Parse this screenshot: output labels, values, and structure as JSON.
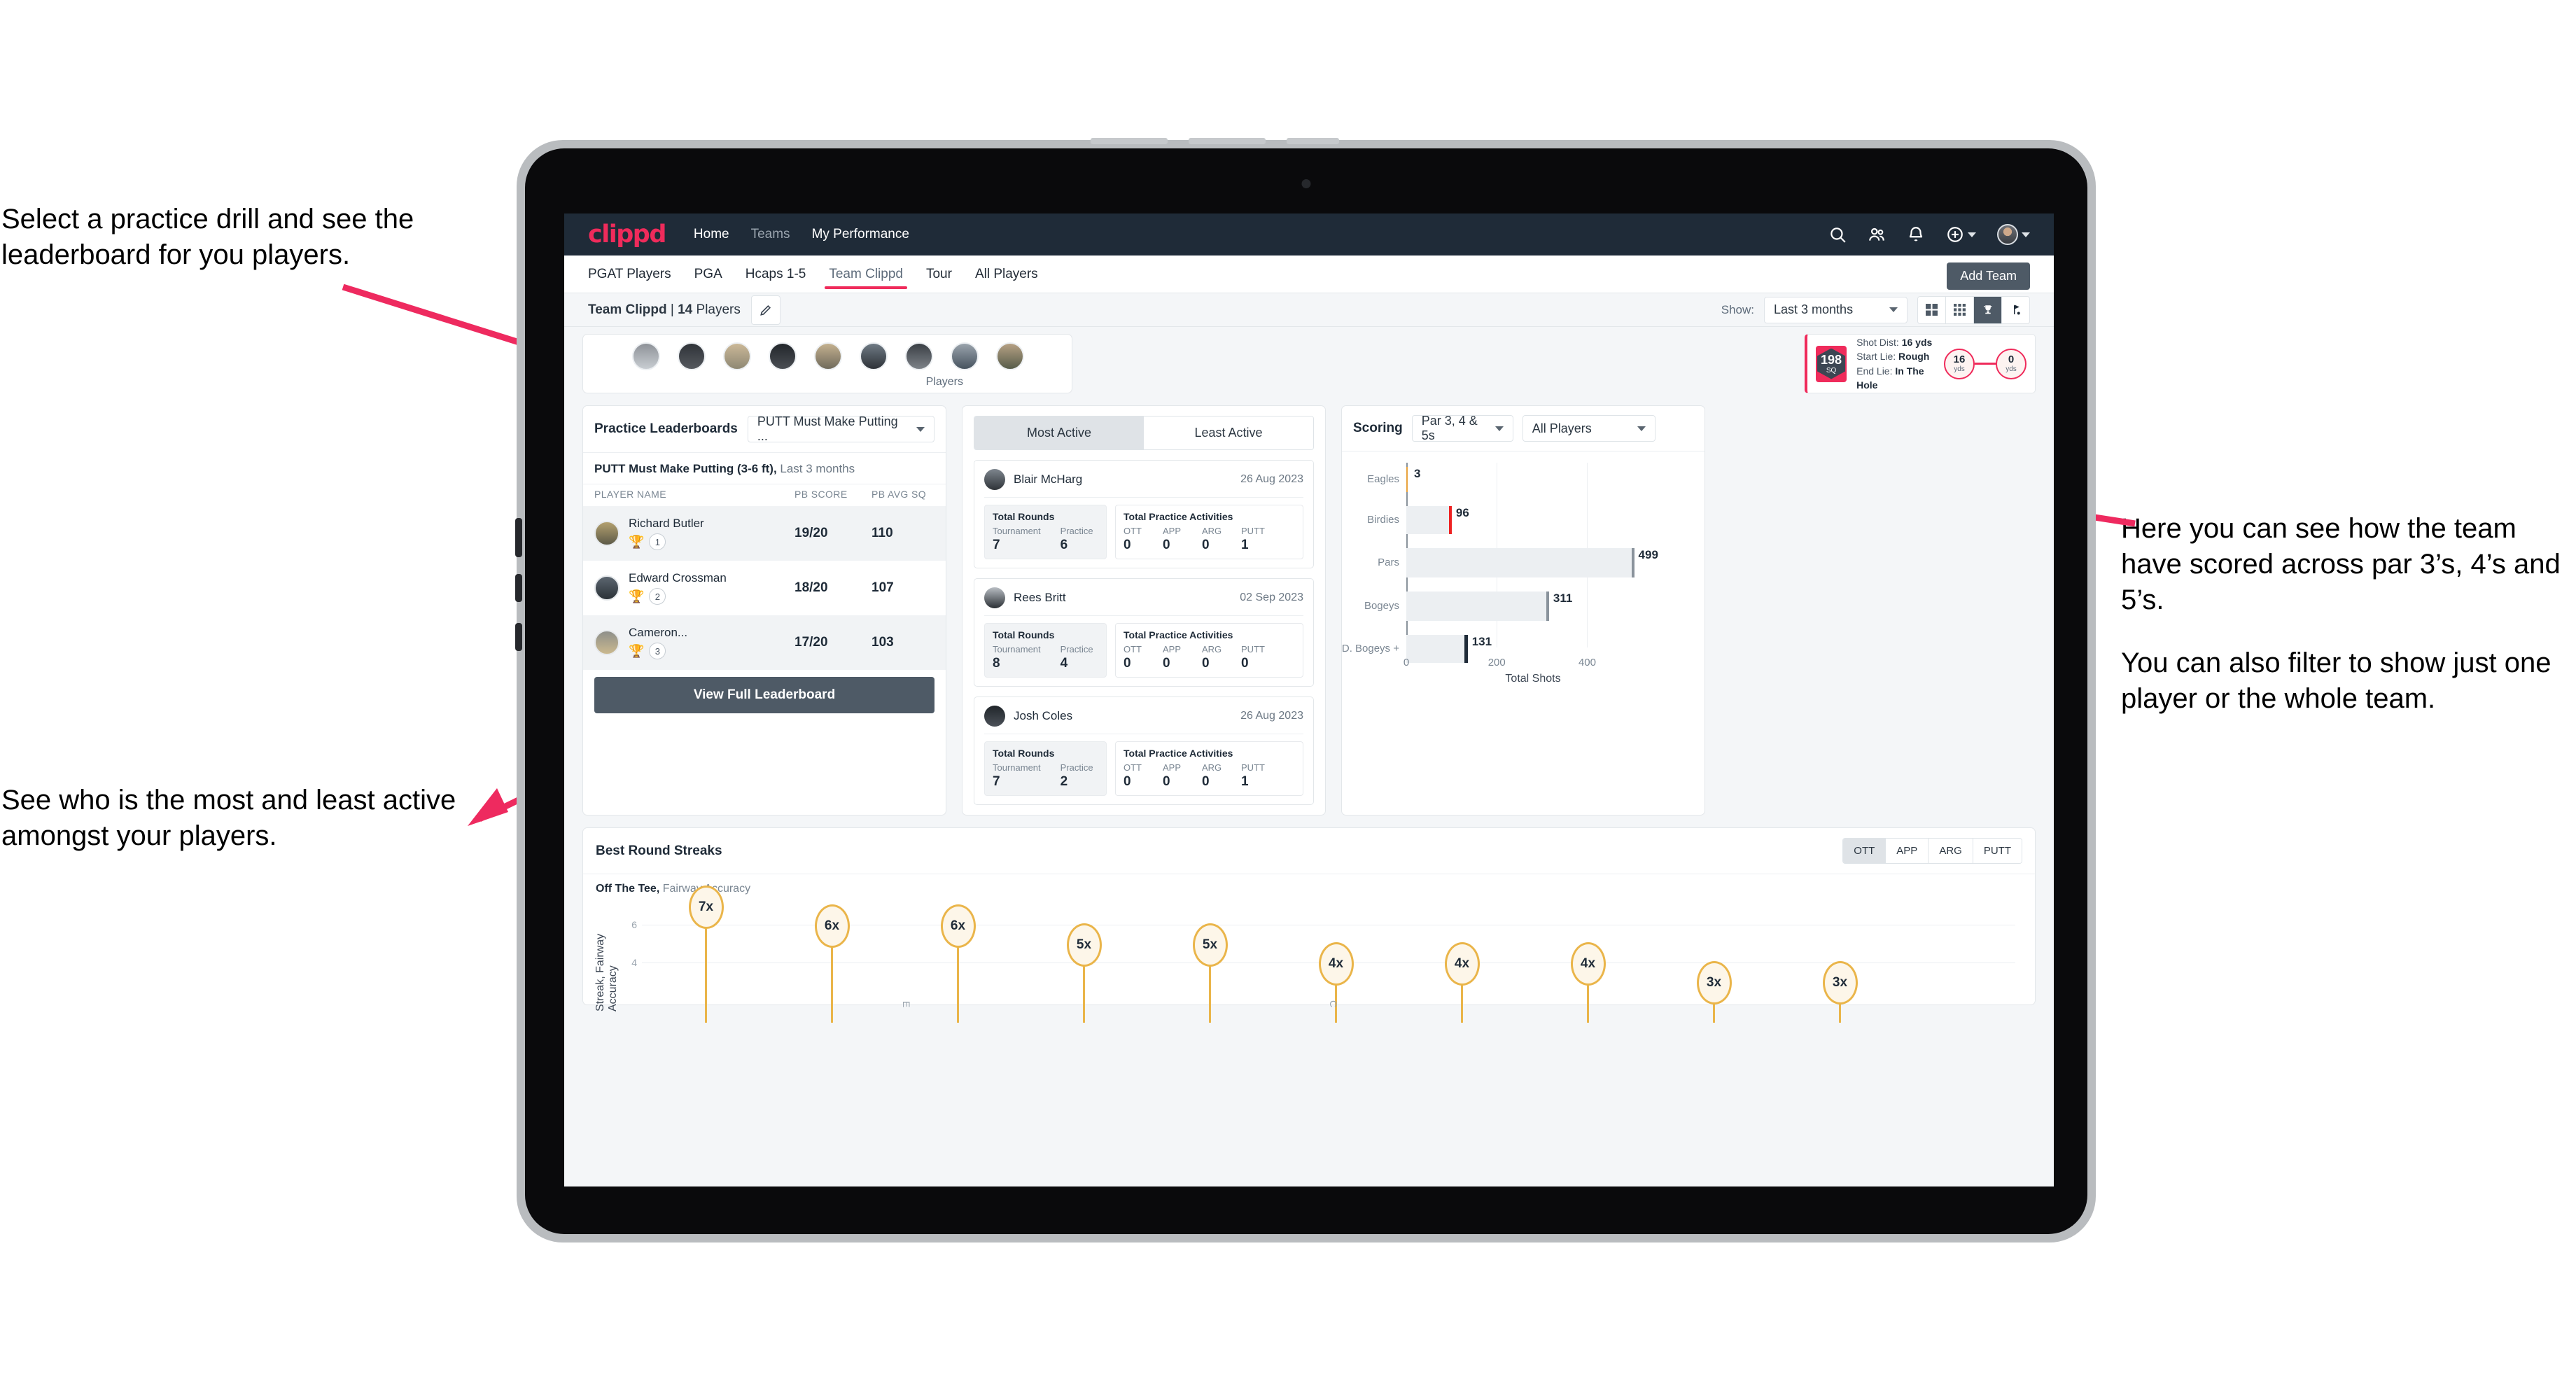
{
  "annotations": {
    "top_left": "Select a practice drill and see the leaderboard for you players.",
    "bottom_left": "See who is the most and least active amongst your players.",
    "right_1": "Here you can see how the team have scored across par 3’s, 4’s and 5’s.",
    "right_2": "You can also filter to show just one player or the whole team.",
    "arrow_color": "#ee2a5f"
  },
  "app": {
    "logo": "clippd",
    "nav": [
      {
        "label": "Home",
        "active": true
      },
      {
        "label": "Teams",
        "active": false
      },
      {
        "label": "My Performance",
        "active": true
      }
    ],
    "icons": {
      "search": "search-icon",
      "people": "people-icon",
      "bell": "bell-icon",
      "plus": "plus-circle-icon",
      "avatar": "user-avatar"
    },
    "tabs": [
      {
        "label": "PGAT Players",
        "active": false
      },
      {
        "label": "PGA",
        "active": false
      },
      {
        "label": "Hcaps 1-5",
        "active": false
      },
      {
        "label": "Team Clippd",
        "active": true
      },
      {
        "label": "Tour",
        "active": false
      },
      {
        "label": "All Players",
        "active": false
      }
    ],
    "add_team_label": "Add Team",
    "subbar": {
      "team_name": "Team Clippd",
      "player_count": "14",
      "players_word": "Players",
      "edit_icon": "pencil-icon",
      "show_label": "Show:",
      "range_value": "Last 3 months",
      "view_buttons": [
        {
          "icon": "grid-large-icon",
          "active": false
        },
        {
          "icon": "grid-small-icon",
          "active": false
        },
        {
          "icon": "trophy-icon",
          "active": true
        },
        {
          "icon": "flag-icon",
          "active": false
        }
      ]
    }
  },
  "player_strip": {
    "caption": "Players",
    "avatar_count": 9
  },
  "shot_card": {
    "sq_value": "198",
    "sq_unit": "SQ",
    "lines": [
      {
        "label": "Shot Dist:",
        "value": "16 yds"
      },
      {
        "label": "Start Lie:",
        "value": "Rough"
      },
      {
        "label": "End Lie:",
        "value": "In The Hole"
      }
    ],
    "start_dist": {
      "value": "16",
      "unit": "yds"
    },
    "end_dist": {
      "value": "0",
      "unit": "yds"
    }
  },
  "leaderboard": {
    "title": "Practice Leaderboards",
    "drill_select": "PUTT Must Make Putting ...",
    "subtitle_bold": "PUTT Must Make Putting (3-6 ft),",
    "subtitle_rest": " Last 3 months",
    "columns": [
      "PLAYER NAME",
      "PB SCORE",
      "PB AVG SQ"
    ],
    "rows": [
      {
        "name": "Richard Butler",
        "rank": "1",
        "trophy": "gold",
        "pb_score": "19/20",
        "pb_avg_sq": "110"
      },
      {
        "name": "Edward Crossman",
        "rank": "2",
        "trophy": "silver",
        "pb_score": "18/20",
        "pb_avg_sq": "107"
      },
      {
        "name": "Cameron...",
        "rank": "3",
        "trophy": "bronze",
        "pb_score": "17/20",
        "pb_avg_sq": "103"
      }
    ],
    "view_full_label": "View Full Leaderboard"
  },
  "activity": {
    "segments": [
      {
        "label": "Most Active",
        "active": true
      },
      {
        "label": "Least Active",
        "active": false
      }
    ],
    "rounds_title": "Total Rounds",
    "rounds_keys": [
      "Tournament",
      "Practice"
    ],
    "practice_title": "Total Practice Activities",
    "practice_keys": [
      "OTT",
      "APP",
      "ARG",
      "PUTT"
    ],
    "players": [
      {
        "name": "Blair McHarg",
        "date": "26 Aug 2023",
        "tournament": "7",
        "practice": "6",
        "ott": "0",
        "app": "0",
        "arg": "0",
        "putt": "1"
      },
      {
        "name": "Rees Britt",
        "date": "02 Sep 2023",
        "tournament": "8",
        "practice": "4",
        "ott": "0",
        "app": "0",
        "arg": "0",
        "putt": "0"
      },
      {
        "name": "Josh Coles",
        "date": "26 Aug 2023",
        "tournament": "7",
        "practice": "2",
        "ott": "0",
        "app": "0",
        "arg": "0",
        "putt": "1"
      }
    ]
  },
  "scoring": {
    "title": "Scoring",
    "par_select": "Par 3, 4 & 5s",
    "player_select": "All Players"
  },
  "streaks": {
    "title": "Best Round Streaks",
    "segments": [
      {
        "label": "OTT",
        "active": true
      },
      {
        "label": "APP",
        "active": false
      },
      {
        "label": "ARG",
        "active": false
      },
      {
        "label": "PUTT",
        "active": false
      }
    ],
    "subtitle_bold": "Off The Tee,",
    "subtitle_rest": " Fairway Accuracy"
  },
  "chart_data": [
    {
      "type": "bar",
      "orientation": "horizontal",
      "title": "Scoring",
      "categories": [
        "Eagles",
        "Birdies",
        "Pars",
        "Bogeys",
        "D. Bogeys +"
      ],
      "values": [
        3,
        96,
        499,
        311,
        131
      ],
      "cap_colors": [
        "#e8a33d",
        "#ee2222",
        "#8a939c",
        "#8a939c",
        "#1f2b38"
      ],
      "bar_color": "#eceff2",
      "xlabel": "Total Shots",
      "ylabel": "",
      "xlim": [
        0,
        560
      ],
      "xticks": [
        0,
        200,
        400
      ],
      "grid": true,
      "legend": "none"
    },
    {
      "type": "bar",
      "orientation": "vertical",
      "title": "Best Round Streaks",
      "subtitle": "Off The Tee, Fairway Accuracy",
      "categories": [
        "",
        "",
        "",
        "",
        "",
        "",
        "",
        "",
        "",
        ""
      ],
      "labels": [
        "7x",
        "6x",
        "6x",
        "5x",
        "5x",
        "4x",
        "4x",
        "4x",
        "3x",
        "3x"
      ],
      "values": [
        7,
        6,
        6,
        5,
        5,
        4,
        4,
        4,
        3,
        3
      ],
      "ylabel": "Streak, Fairway Accuracy",
      "yticks": [
        4,
        6
      ],
      "ylim": [
        0,
        8
      ],
      "marker_color": "#eab54a",
      "grid": true,
      "legend": "none"
    }
  ]
}
